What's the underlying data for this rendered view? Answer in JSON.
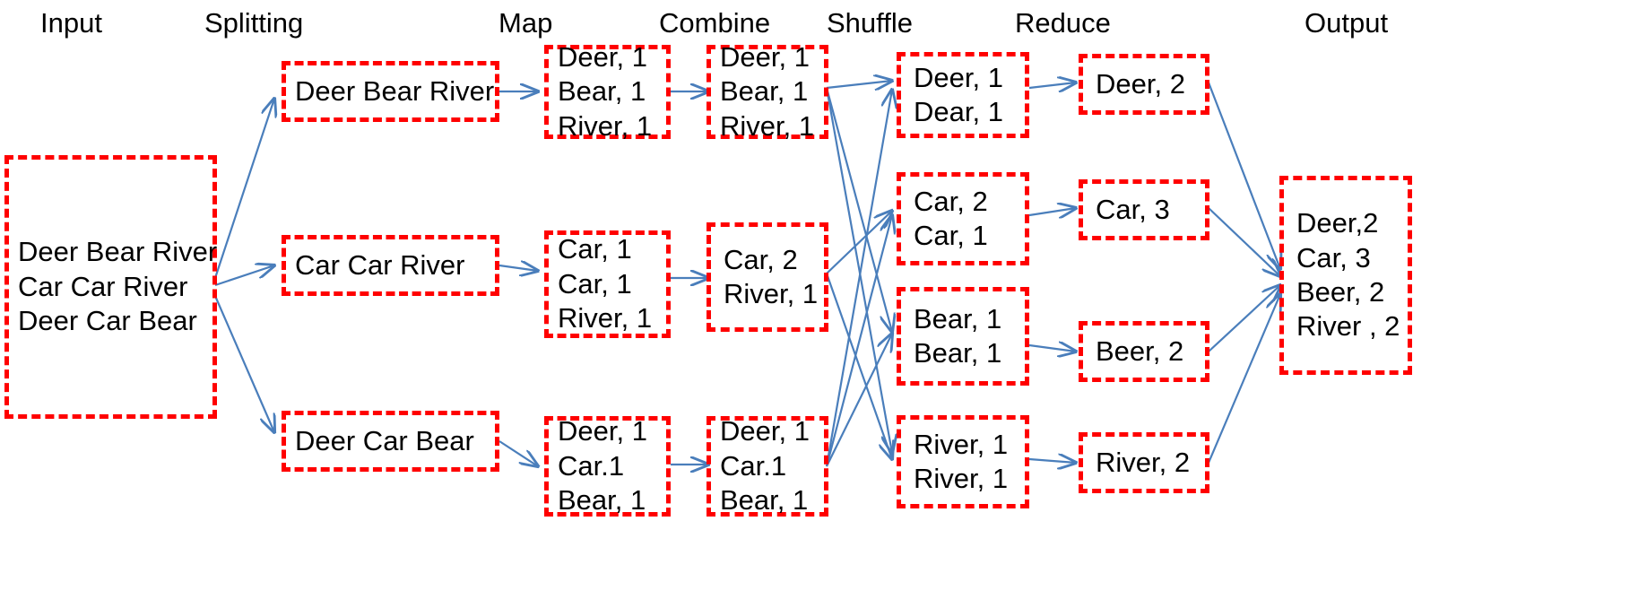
{
  "diagram": {
    "title": "MapReduce word count dataflow",
    "box_border_color": "#ff0000",
    "arrow_color": "#4a7ebb",
    "text_color": "#000000",
    "background": "#ffffff"
  },
  "columns": [
    {
      "key": "input",
      "label": "Input"
    },
    {
      "key": "splitting",
      "label": "Splitting"
    },
    {
      "key": "map",
      "label": "Map"
    },
    {
      "key": "combine",
      "label": "Combine"
    },
    {
      "key": "shuffle",
      "label": "Shuffle"
    },
    {
      "key": "reduce",
      "label": "Reduce"
    },
    {
      "key": "output",
      "label": "Output"
    }
  ],
  "nodes": {
    "input": [
      {
        "id": "input-0",
        "lines": [
          "Deer Bear River",
          "Car Car River",
          "Deer Car Bear"
        ]
      }
    ],
    "splitting": [
      {
        "id": "split-0",
        "lines": [
          "Deer Bear River"
        ]
      },
      {
        "id": "split-1",
        "lines": [
          "Car Car River"
        ]
      },
      {
        "id": "split-2",
        "lines": [
          "Deer Car Bear"
        ]
      }
    ],
    "map": [
      {
        "id": "map-0",
        "lines": [
          "Deer, 1",
          "Bear, 1",
          "River, 1"
        ]
      },
      {
        "id": "map-1",
        "lines": [
          "Car, 1",
          "Car, 1",
          "River, 1"
        ]
      },
      {
        "id": "map-2",
        "lines": [
          "Deer, 1",
          "Car.1",
          "Bear, 1"
        ]
      }
    ],
    "combine": [
      {
        "id": "comb-0",
        "lines": [
          "Deer, 1",
          "Bear, 1",
          "River, 1"
        ]
      },
      {
        "id": "comb-1",
        "lines": [
          "Car, 2",
          "River, 1"
        ]
      },
      {
        "id": "comb-2",
        "lines": [
          "Deer, 1",
          "Car.1",
          "Bear, 1"
        ]
      }
    ],
    "shuffle": [
      {
        "id": "shuf-0",
        "lines": [
          "Deer, 1",
          "Dear, 1"
        ]
      },
      {
        "id": "shuf-1",
        "lines": [
          "Car, 2",
          "Car, 1"
        ]
      },
      {
        "id": "shuf-2",
        "lines": [
          "Bear, 1",
          "Bear, 1"
        ]
      },
      {
        "id": "shuf-3",
        "lines": [
          "River, 1",
          "River, 1"
        ]
      }
    ],
    "reduce": [
      {
        "id": "red-0",
        "lines": [
          "Deer, 2"
        ]
      },
      {
        "id": "red-1",
        "lines": [
          "Car, 3"
        ]
      },
      {
        "id": "red-2",
        "lines": [
          "Beer, 2"
        ]
      },
      {
        "id": "red-3",
        "lines": [
          "River, 2"
        ]
      }
    ],
    "output": [
      {
        "id": "out-0",
        "lines": [
          "Deer,2",
          "Car, 3",
          "Beer, 2",
          "River , 2"
        ]
      }
    ]
  }
}
